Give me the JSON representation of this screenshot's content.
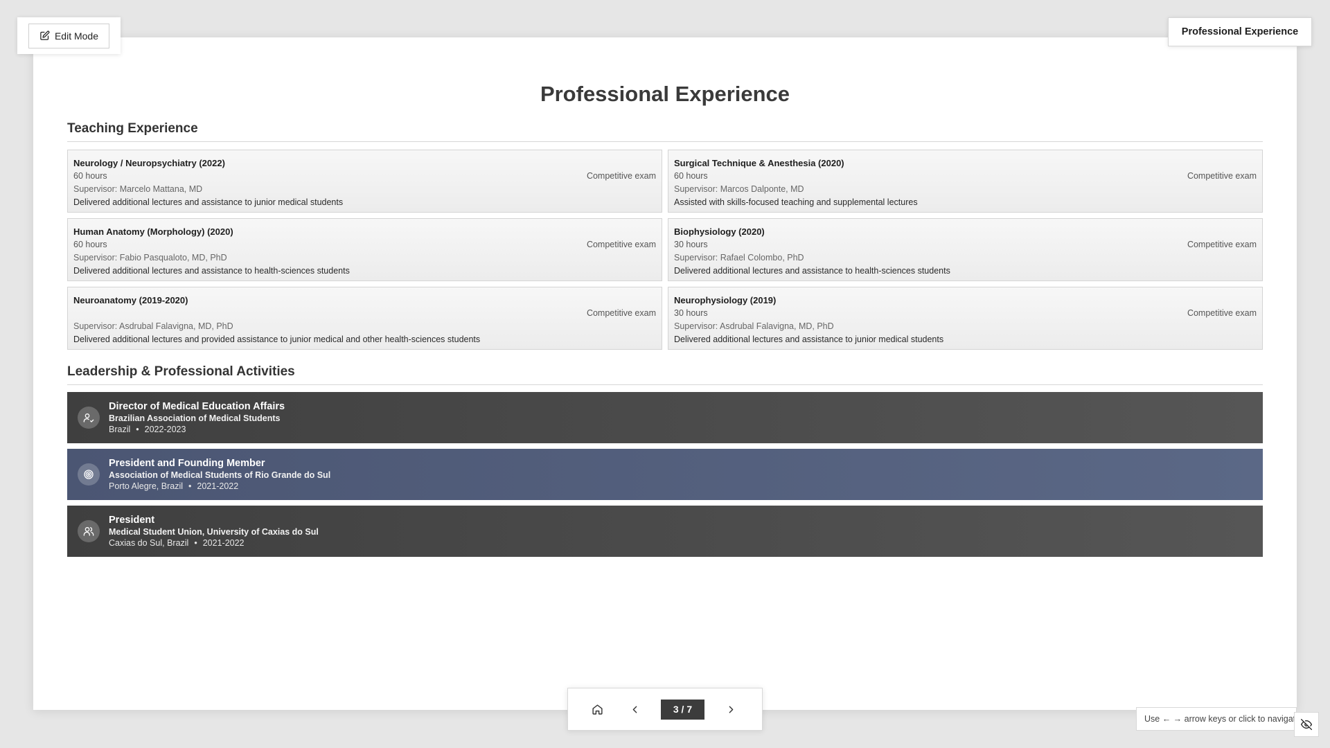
{
  "window": {
    "title_badge": "Professional Experience"
  },
  "toolbar": {
    "edit_label": "Edit Mode"
  },
  "slide": {
    "title": "Professional Experience",
    "teaching_title": "Teaching Experience",
    "leadership_title": "Leadership & Professional Activities"
  },
  "teaching": [
    {
      "title": "Neurology / Neuropsychiatry (2022)",
      "hours": "60 hours",
      "type": "Competitive exam",
      "supervisor": "Supervisor: Marcelo Mattana, MD",
      "description": "Delivered additional lectures and assistance to junior medical students"
    },
    {
      "title": "Surgical Technique & Anesthesia (2020)",
      "hours": "60 hours",
      "type": "Competitive exam",
      "supervisor": "Supervisor: Marcos Dalponte, MD",
      "description": "Assisted with skills-focused teaching and supplemental lectures"
    },
    {
      "title": "Human Anatomy (Morphology) (2020)",
      "hours": "60 hours",
      "type": "Competitive exam",
      "supervisor": "Supervisor: Fabio Pasqualoto, MD, PhD",
      "description": "Delivered additional lectures and assistance to health-sciences students"
    },
    {
      "title": "Biophysiology (2020)",
      "hours": "30 hours",
      "type": "Competitive exam",
      "supervisor": "Supervisor: Rafael Colombo, PhD",
      "description": "Delivered additional lectures and assistance to health-sciences students"
    },
    {
      "title": "Neuroanatomy (2019-2020)",
      "hours": "",
      "type": "Competitive exam",
      "supervisor": "Supervisor: Asdrubal Falavigna, MD, PhD",
      "description": "Delivered additional lectures and provided assistance to junior medical and other health-sciences students"
    },
    {
      "title": "Neurophysiology (2019)",
      "hours": "30 hours",
      "type": "Competitive exam",
      "supervisor": "Supervisor: Asdrubal Falavigna, MD, PhD",
      "description": "Delivered additional lectures and assistance to junior medical students"
    }
  ],
  "leadership": [
    {
      "role": "Director of Medical Education Affairs",
      "org": "Brazilian Association of Medical Students",
      "location": "Brazil",
      "period": "2022-2023",
      "icon": "user-check-icon",
      "dot": "•"
    },
    {
      "role": "President and Founding Member",
      "org": "Association of Medical Students of Rio Grande do Sul",
      "location": "Porto Alegre, Brazil",
      "period": "2021-2022",
      "icon": "target-icon",
      "dot": "•"
    },
    {
      "role": "President",
      "org": "Medical Student Union, University of Caxias do Sul",
      "location": "Caxias do Sul, Brazil",
      "period": "2021-2022",
      "icon": "users-icon",
      "dot": "•"
    }
  ],
  "nav": {
    "page_indicator": "3 / 7"
  },
  "hint": {
    "text": "Use ← → arrow keys or click to navigate"
  },
  "colors": {
    "dark_card": "#4a4a4a",
    "blue_card": "#53607d",
    "page_indicator_bg": "#3c3c3c"
  }
}
